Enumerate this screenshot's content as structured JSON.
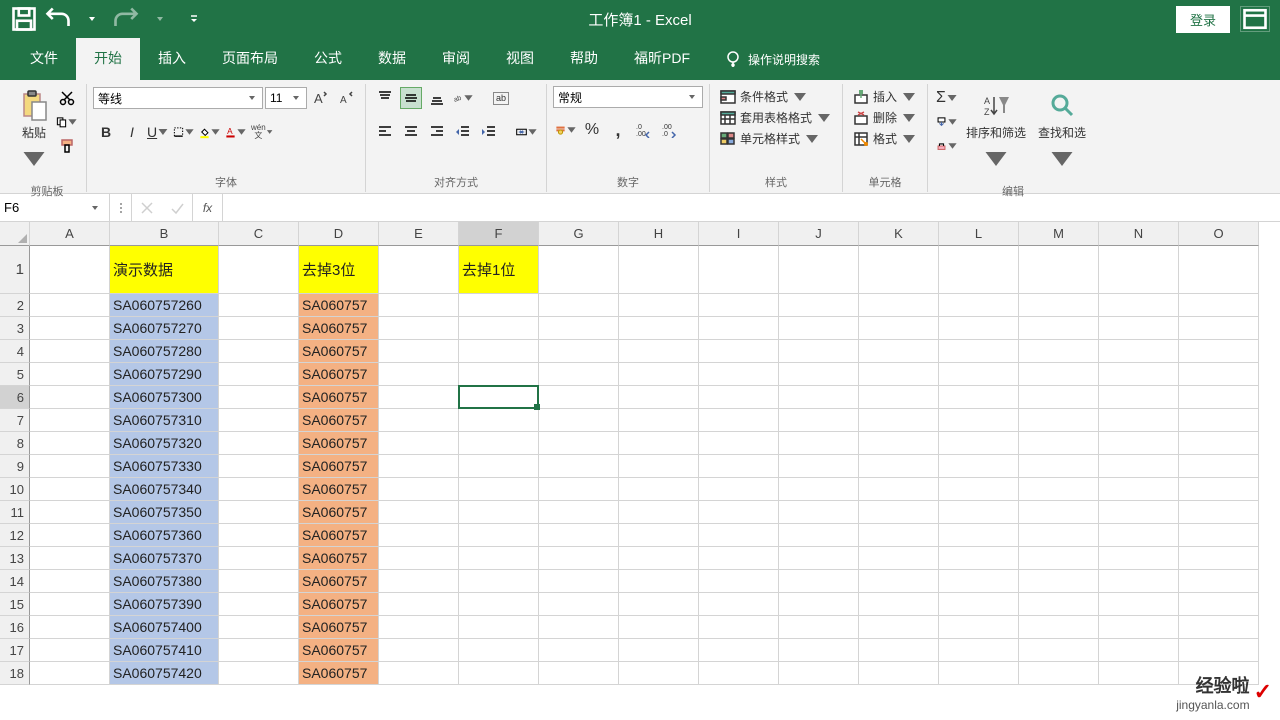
{
  "titlebar": {
    "title": "工作簿1  -  Excel",
    "login": "登录"
  },
  "tabs": {
    "file": "文件",
    "home": "开始",
    "insert": "插入",
    "layout": "页面布局",
    "formulas": "公式",
    "data": "数据",
    "review": "审阅",
    "view": "视图",
    "help": "帮助",
    "pdf": "福昕PDF",
    "whatdo": "操作说明搜索"
  },
  "ribbon": {
    "clipboard": {
      "paste": "粘贴",
      "label": "剪贴板"
    },
    "font": {
      "name": "等线",
      "size": "11",
      "label": "字体",
      "wen": "wén",
      "wen2": "文"
    },
    "align": {
      "label": "对齐方式",
      "ab": "ab"
    },
    "number": {
      "label": "数字",
      "format": "常规"
    },
    "styles": {
      "cond": "条件格式",
      "tbl": "套用表格格式",
      "cell": "单元格样式",
      "label": "样式"
    },
    "cells": {
      "ins": "插入",
      "del": "删除",
      "fmt": "格式",
      "label": "单元格"
    },
    "edit": {
      "sort": "排序和筛选",
      "find": "查找和选",
      "label": "编辑"
    }
  },
  "namebox": "F6",
  "fx": "fx",
  "formula": "",
  "columns": [
    "A",
    "B",
    "C",
    "D",
    "E",
    "F",
    "G",
    "H",
    "I",
    "J",
    "K",
    "L",
    "M",
    "N",
    "O"
  ],
  "headers": {
    "B": "演示数据",
    "D": "去掉3位",
    "F": "去掉1位"
  },
  "dataB": [
    "SA060757260",
    "SA060757270",
    "SA060757280",
    "SA060757290",
    "SA060757300",
    "SA060757310",
    "SA060757320",
    "SA060757330",
    "SA060757340",
    "SA060757350",
    "SA060757360",
    "SA060757370",
    "SA060757380",
    "SA060757390",
    "SA060757400",
    "SA060757410",
    "SA060757420"
  ],
  "dataD": [
    "SA060757",
    "SA060757",
    "SA060757",
    "SA060757",
    "SA060757",
    "SA060757",
    "SA060757",
    "SA060757",
    "SA060757",
    "SA060757",
    "SA060757",
    "SA060757",
    "SA060757",
    "SA060757",
    "SA060757",
    "SA060757",
    "SA060757"
  ],
  "active_cell": {
    "col": "F",
    "row": 6
  },
  "watermark": {
    "text1": "经验啦",
    "text2": "jingyanla.com"
  }
}
